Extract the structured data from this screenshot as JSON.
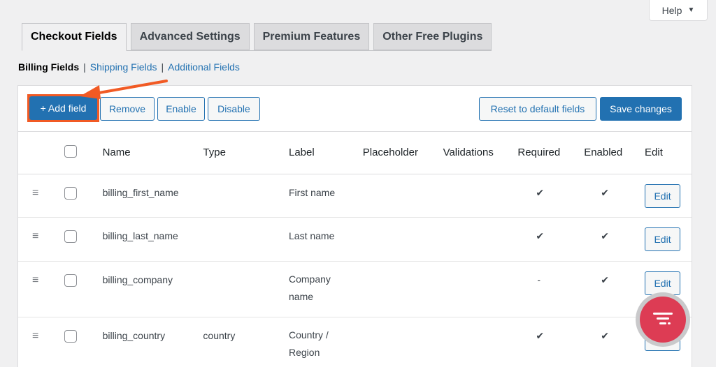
{
  "help": {
    "label": "Help",
    "caret": "▼"
  },
  "tabs": [
    {
      "label": "Checkout Fields",
      "active": true
    },
    {
      "label": "Advanced Settings",
      "active": false
    },
    {
      "label": "Premium Features",
      "active": false
    },
    {
      "label": "Other Free Plugins",
      "active": false
    }
  ],
  "subnav": {
    "current": "Billing Fields",
    "sep": "|",
    "links": [
      "Shipping Fields",
      "Additional Fields"
    ]
  },
  "toolbar": {
    "add_label": "+ Add field",
    "remove_label": "Remove",
    "enable_label": "Enable",
    "disable_label": "Disable",
    "reset_label": "Reset to default fields",
    "save_label": "Save changes"
  },
  "table": {
    "headers": [
      "Name",
      "Type",
      "Label",
      "Placeholder",
      "Validations",
      "Required",
      "Enabled",
      "Edit"
    ],
    "rows": [
      {
        "name": "billing_first_name",
        "type": "",
        "label": "First name",
        "label2": "",
        "placeholder": "",
        "validations": "",
        "required": "✔",
        "enabled": "✔",
        "edit": "Edit"
      },
      {
        "name": "billing_last_name",
        "type": "",
        "label": "Last name",
        "label2": "",
        "placeholder": "",
        "validations": "",
        "required": "✔",
        "enabled": "✔",
        "edit": "Edit"
      },
      {
        "name": "billing_company",
        "type": "",
        "label": "Company",
        "label2": "name",
        "placeholder": "",
        "validations": "",
        "required": "-",
        "enabled": "✔",
        "edit": "Edit"
      },
      {
        "name": "billing_country",
        "type": "country",
        "label": "Country /",
        "label2": "Region",
        "placeholder": "",
        "validations": "",
        "required": "✔",
        "enabled": "✔",
        "edit": "Edit"
      }
    ]
  },
  "grip_icon": "≡",
  "colors": {
    "accent": "#2271b1",
    "highlight": "#f15a24",
    "fab": "#dd3c54"
  }
}
